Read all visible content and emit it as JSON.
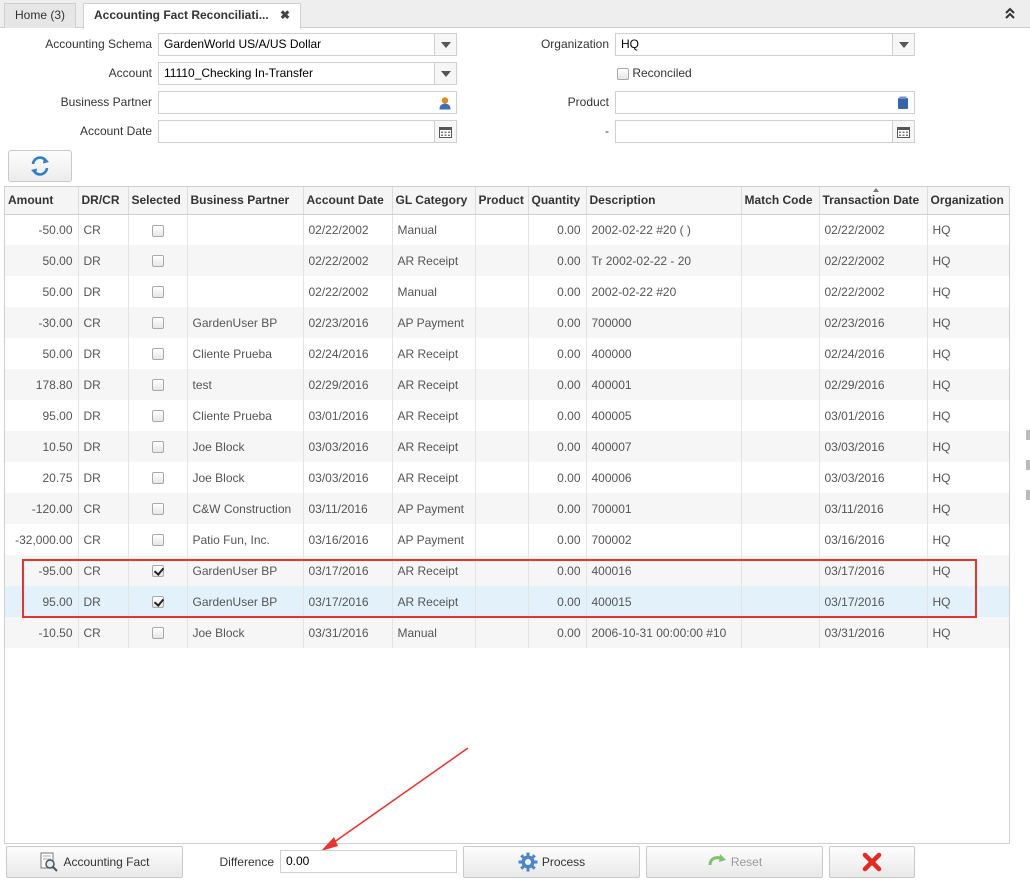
{
  "tabs": [
    {
      "label": "Home (3)"
    },
    {
      "label": "Accounting Fact Reconciliati...",
      "close": "✖"
    }
  ],
  "form": {
    "accounting_schema": {
      "label": "Accounting Schema",
      "value": "GardenWorld US/A/US Dollar"
    },
    "account": {
      "label": "Account",
      "value": "11110_Checking In-Transfer"
    },
    "business_partner": {
      "label": "Business Partner",
      "value": ""
    },
    "account_date": {
      "label": "Account Date",
      "value": ""
    },
    "organization": {
      "label": "Organization",
      "value": "HQ"
    },
    "reconciled": {
      "label": "Reconciled",
      "checked": false
    },
    "product": {
      "label": "Product",
      "value": ""
    },
    "date_to": {
      "label": "-",
      "value": ""
    }
  },
  "grid": {
    "columns": [
      "Amount",
      "DR/CR",
      "Selected",
      "Business Partner",
      "Account Date",
      "GL Category",
      "Product",
      "Quantity",
      "Description",
      "Match Code",
      "Transaction Date",
      "Organization"
    ],
    "sorted_column": "Transaction Date",
    "rows": [
      {
        "amount": "-50.00",
        "drcr": "CR",
        "selected": false,
        "bp": "",
        "acct_date": "02/22/2002",
        "gl": "Manual",
        "product": "",
        "qty": "0.00",
        "desc": "2002-02-22 #20 ( )",
        "match": "",
        "trx_date": "02/22/2002",
        "org": "HQ"
      },
      {
        "amount": "50.00",
        "drcr": "DR",
        "selected": false,
        "bp": "",
        "acct_date": "02/22/2002",
        "gl": "AR Receipt",
        "product": "",
        "qty": "0.00",
        "desc": "Tr 2002-02-22 - 20",
        "match": "",
        "trx_date": "02/22/2002",
        "org": "HQ"
      },
      {
        "amount": "50.00",
        "drcr": "DR",
        "selected": false,
        "bp": "",
        "acct_date": "02/22/2002",
        "gl": "Manual",
        "product": "",
        "qty": "0.00",
        "desc": "2002-02-22 #20",
        "match": "",
        "trx_date": "02/22/2002",
        "org": "HQ"
      },
      {
        "amount": "-30.00",
        "drcr": "CR",
        "selected": false,
        "bp": "GardenUser BP",
        "acct_date": "02/23/2016",
        "gl": "AP Payment",
        "product": "",
        "qty": "0.00",
        "desc": "700000",
        "match": "",
        "trx_date": "02/23/2016",
        "org": "HQ"
      },
      {
        "amount": "50.00",
        "drcr": "DR",
        "selected": false,
        "bp": "Cliente Prueba",
        "acct_date": "02/24/2016",
        "gl": "AR Receipt",
        "product": "",
        "qty": "0.00",
        "desc": "400000",
        "match": "",
        "trx_date": "02/24/2016",
        "org": "HQ"
      },
      {
        "amount": "178.80",
        "drcr": "DR",
        "selected": false,
        "bp": "test",
        "acct_date": "02/29/2016",
        "gl": "AR Receipt",
        "product": "",
        "qty": "0.00",
        "desc": "400001",
        "match": "",
        "trx_date": "02/29/2016",
        "org": "HQ"
      },
      {
        "amount": "95.00",
        "drcr": "DR",
        "selected": false,
        "bp": "Cliente Prueba",
        "acct_date": "03/01/2016",
        "gl": "AR Receipt",
        "product": "",
        "qty": "0.00",
        "desc": "400005",
        "match": "",
        "trx_date": "03/01/2016",
        "org": "HQ"
      },
      {
        "amount": "10.50",
        "drcr": "DR",
        "selected": false,
        "bp": "Joe Block",
        "acct_date": "03/03/2016",
        "gl": "AR Receipt",
        "product": "",
        "qty": "0.00",
        "desc": "400007",
        "match": "",
        "trx_date": "03/03/2016",
        "org": "HQ"
      },
      {
        "amount": "20.75",
        "drcr": "DR",
        "selected": false,
        "bp": "Joe Block",
        "acct_date": "03/03/2016",
        "gl": "AR Receipt",
        "product": "",
        "qty": "0.00",
        "desc": "400006",
        "match": "",
        "trx_date": "03/03/2016",
        "org": "HQ"
      },
      {
        "amount": "-120.00",
        "drcr": "CR",
        "selected": false,
        "bp": "C&W Construction",
        "acct_date": "03/11/2016",
        "gl": "AP Payment",
        "product": "",
        "qty": "0.00",
        "desc": "700001",
        "match": "",
        "trx_date": "03/11/2016",
        "org": "HQ"
      },
      {
        "amount": "-32,000.00",
        "drcr": "CR",
        "selected": false,
        "bp": "Patio Fun, Inc.",
        "acct_date": "03/16/2016",
        "gl": "AP Payment",
        "product": "",
        "qty": "0.00",
        "desc": "700002",
        "match": "",
        "trx_date": "03/16/2016",
        "org": "HQ"
      },
      {
        "amount": "-95.00",
        "drcr": "CR",
        "selected": true,
        "bp": "GardenUser BP",
        "acct_date": "03/17/2016",
        "gl": "AR Receipt",
        "product": "",
        "qty": "0.00",
        "desc": "400016",
        "match": "",
        "trx_date": "03/17/2016",
        "org": "HQ"
      },
      {
        "amount": "95.00",
        "drcr": "DR",
        "selected": true,
        "bp": "GardenUser BP",
        "acct_date": "03/17/2016",
        "gl": "AR Receipt",
        "product": "",
        "qty": "0.00",
        "desc": "400015",
        "match": "",
        "trx_date": "03/17/2016",
        "org": "HQ"
      },
      {
        "amount": "-10.50",
        "drcr": "CR",
        "selected": false,
        "bp": "Joe Block",
        "acct_date": "03/31/2016",
        "gl": "Manual",
        "product": "",
        "qty": "0.00",
        "desc": "2006-10-31 00:00:00 #10",
        "match": "",
        "trx_date": "03/31/2016",
        "org": "HQ"
      }
    ]
  },
  "bottom": {
    "accounting_fact_label": "Accounting Fact",
    "difference_label": "Difference",
    "difference_value": "0.00",
    "process_label": "Process",
    "reset_label": "Reset"
  },
  "colors": {
    "annotation": "#e8322f",
    "selected_row": "#e3f1fb"
  }
}
